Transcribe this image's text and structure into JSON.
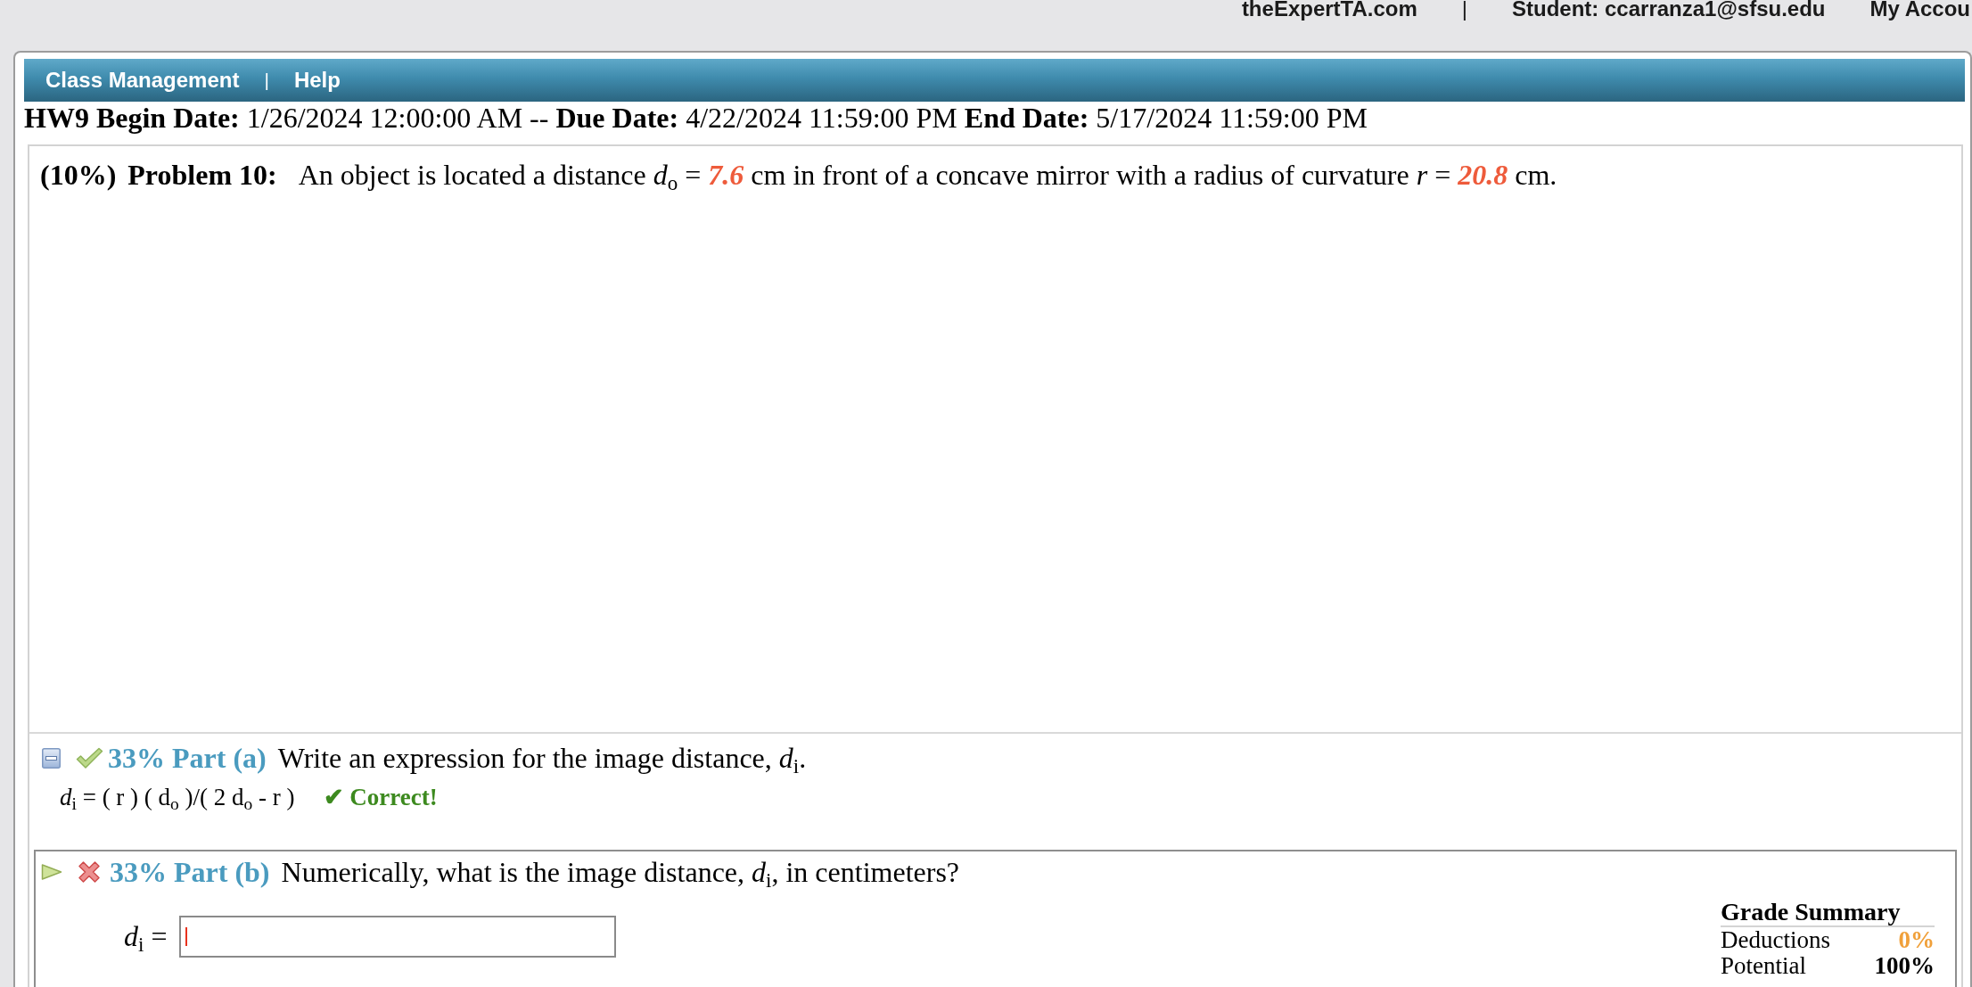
{
  "top_bar": {
    "items": [
      {
        "kind": "link",
        "text": "theExpertTA.com"
      },
      {
        "kind": "separator",
        "text": "|"
      },
      {
        "kind": "text",
        "text": "Student: ccarranza1@sfsu.edu"
      },
      {
        "kind": "link",
        "text": "My Accou"
      }
    ]
  },
  "nav": {
    "items": [
      {
        "kind": "link",
        "text": "Class Management"
      },
      {
        "kind": "separator",
        "text": "|"
      },
      {
        "kind": "link",
        "text": "Help"
      }
    ]
  },
  "assignment_dates": "**HW9 Begin Date:** 1/26/2024 12:00:00 AM -- **Due Date:** 4/22/2024 11:59:00 PM **End Date:** 5/17/2024 11:59:00 PM",
  "problem": {
    "weight": "(10%)",
    "title": "Problem 10:",
    "statement": "An object is located a distance *d*$_{o}$ = **7.6** cm in front of a concave mirror with a radius of curvature *r* = **20.8** cm."
  },
  "parts": [
    {
      "kind": "completed",
      "correct": true,
      "heading": "33% Part (a)",
      "question": "Write an expression for the image distance, *d*$_{i}$.",
      "answer": "*d*$_{i}$ = ( r ) ( d$_{o}$ )/( 2 d$_{o}$ - r )",
      "feedback": "✔ Correct!"
    },
    {
      "kind": "active",
      "correct": false,
      "heading": "33% Part (b)",
      "question": "Numerically, what is the image distance, *d*$_{i}$, in centimeters?",
      "answer_label": "*d*$_{i}$ =",
      "focused": true,
      "grade_summary": {
        "title": "Grade Summary",
        "rows": [
          {
            "kind": "deductions",
            "label": "Deductions",
            "value": "0%"
          },
          {
            "kind": "potential",
            "label": "Potential",
            "value": "100%"
          }
        ]
      }
    }
  ]
}
